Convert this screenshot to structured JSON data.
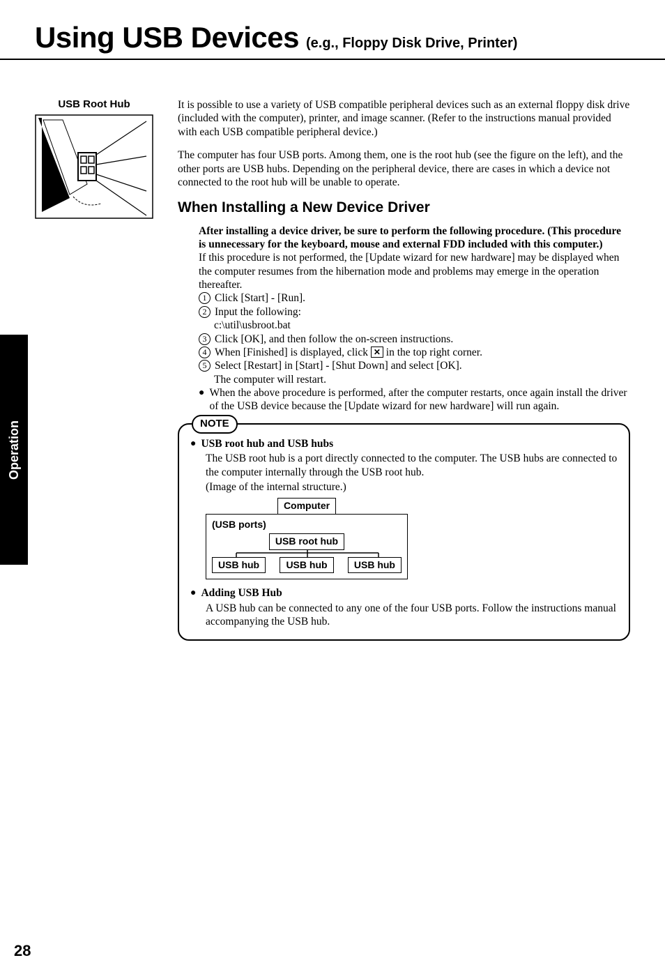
{
  "title": "Using USB Devices",
  "subtitle": "(e.g., Floppy Disk Drive, Printer)",
  "side_tab": "Operation",
  "page_number": "28",
  "left": {
    "caption": "USB Root Hub"
  },
  "intro": {
    "p1": "It is possible to use a variety of USB compatible peripheral devices such as an external floppy disk drive (included with the computer), printer, and image scanner. (Refer to the instructions manual provided with each USB compatible peripheral device.)",
    "p2": "The computer has four USB ports. Among them, one is the root hub (see the figure on the left), and the other ports are USB hubs. Depending on the peripheral device, there are cases in which a device not connected to the root hub will be unable to operate."
  },
  "section": {
    "heading": "When Installing a New Device Driver",
    "lead": "After installing a device driver, be sure to perform the following procedure. (This procedure is unnecessary for the keyboard, mouse and external FDD included with this computer.)",
    "warn": "If this procedure is not performed, the [Update wizard for new hardware] may be displayed when the computer resumes from the hibernation mode and problems may emerge in the operation thereafter.",
    "steps": {
      "s1": "Click [Start] - [Run].",
      "s2": "Input the following:",
      "s2b": "c:\\util\\usbroot.bat",
      "s3": "Click [OK], and then follow the on-screen instructions.",
      "s4a": "When [Finished] is displayed, click ",
      "s4b": " in the top right corner.",
      "s5": "Select [Restart] in [Start] - [Shut Down] and select [OK].",
      "s5b": "The computer will restart."
    },
    "bullet": "When the above procedure is performed, after the computer restarts, once again install the driver of the USB device because the [Update wizard for new hardware] will run again."
  },
  "note": {
    "label": "NOTE",
    "b1_title": "USB root hub and USB hubs",
    "b1_p1": "The USB root hub is a port directly connected to the computer. The USB hubs are connected to the computer internally through the USB root hub.",
    "b1_p2": "(Image of the internal structure.)",
    "diagram": {
      "computer": "Computer",
      "ports": "(USB ports)",
      "root": "USB root hub",
      "hub": "USB hub"
    },
    "b2_title": "Adding USB Hub",
    "b2_p": "A USB hub can be connected to any one of the four USB ports. Follow the instructions manual accompanying the USB hub."
  }
}
